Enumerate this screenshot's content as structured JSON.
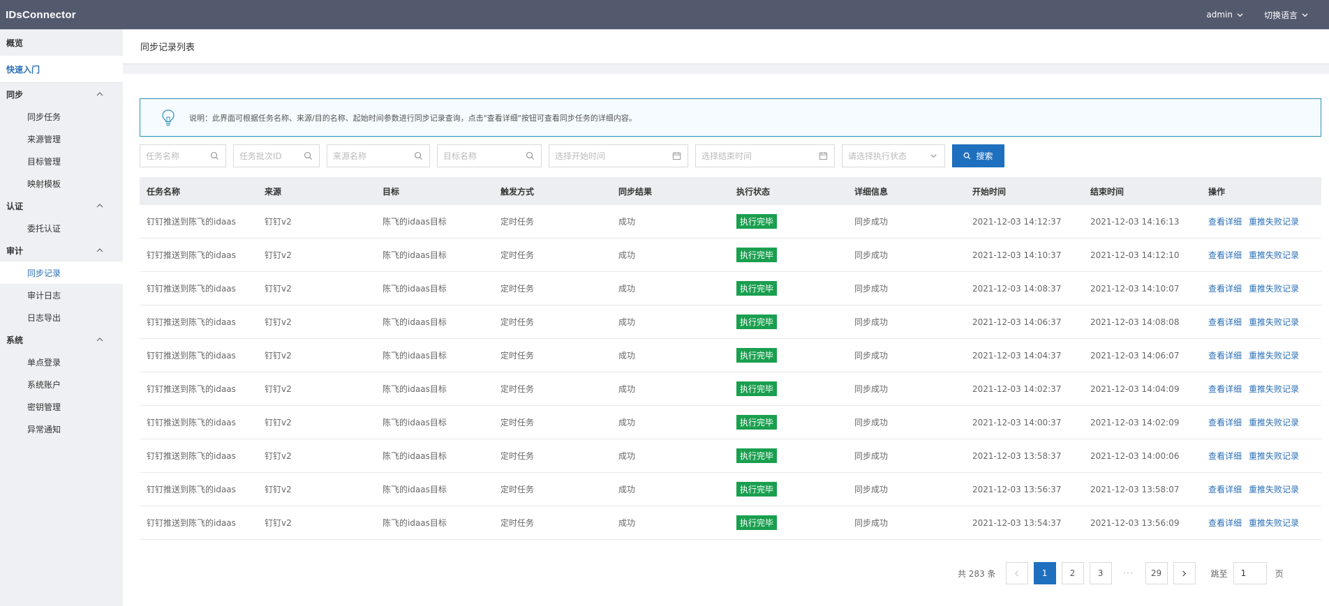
{
  "app": {
    "brand": "IDsConnector",
    "user": "admin",
    "language": "切换语言"
  },
  "sidebar": {
    "overview": "概览",
    "quickstart": "快速入门",
    "groups": [
      {
        "label": "同步",
        "items": [
          "同步任务",
          "来源管理",
          "目标管理",
          "映射模板"
        ]
      },
      {
        "label": "认证",
        "items": [
          "委托认证"
        ]
      },
      {
        "label": "审计",
        "items": [
          "同步记录",
          "审计日志",
          "日志导出"
        ]
      },
      {
        "label": "系统",
        "items": [
          "单点登录",
          "系统账户",
          "密钥管理",
          "异常通知"
        ]
      }
    ]
  },
  "page": {
    "title": "同步记录列表",
    "notice": "说明：此界面可根据任务名称、来源/目的名称、起始时间参数进行同步记录查询，点击\"查看详细\"按钮可查看同步任务的详细内容。"
  },
  "filters": {
    "task_name_placeholder": "任务名称",
    "batch_id_placeholder": "任务批次ID",
    "source_placeholder": "来源名称",
    "target_placeholder": "目标名称",
    "start_time_placeholder": "选择开始时间",
    "end_time_placeholder": "选择结束时间",
    "status_placeholder": "请选择执行状态",
    "search_label": "搜索"
  },
  "table": {
    "headers": [
      "任务名称",
      "来源",
      "目标",
      "触发方式",
      "同步结果",
      "执行状态",
      "详细信息",
      "开始时间",
      "结束时间",
      "操作"
    ],
    "action_view": "查看详细",
    "action_retry": "重推失败记录",
    "rows": [
      {
        "name": "钉钉推送到陈飞的idaas",
        "source": "钉钉v2",
        "target": "陈飞的idaas目标",
        "trigger": "定时任务",
        "result": "成功",
        "status": "执行完毕",
        "detail": "同步成功",
        "start": "2021-12-03 14:12:37",
        "end": "2021-12-03 14:16:13"
      },
      {
        "name": "钉钉推送到陈飞的idaas",
        "source": "钉钉v2",
        "target": "陈飞的idaas目标",
        "trigger": "定时任务",
        "result": "成功",
        "status": "执行完毕",
        "detail": "同步成功",
        "start": "2021-12-03 14:10:37",
        "end": "2021-12-03 14:12:10"
      },
      {
        "name": "钉钉推送到陈飞的idaas",
        "source": "钉钉v2",
        "target": "陈飞的idaas目标",
        "trigger": "定时任务",
        "result": "成功",
        "status": "执行完毕",
        "detail": "同步成功",
        "start": "2021-12-03 14:08:37",
        "end": "2021-12-03 14:10:07"
      },
      {
        "name": "钉钉推送到陈飞的idaas",
        "source": "钉钉v2",
        "target": "陈飞的idaas目标",
        "trigger": "定时任务",
        "result": "成功",
        "status": "执行完毕",
        "detail": "同步成功",
        "start": "2021-12-03 14:06:37",
        "end": "2021-12-03 14:08:08"
      },
      {
        "name": "钉钉推送到陈飞的idaas",
        "source": "钉钉v2",
        "target": "陈飞的idaas目标",
        "trigger": "定时任务",
        "result": "成功",
        "status": "执行完毕",
        "detail": "同步成功",
        "start": "2021-12-03 14:04:37",
        "end": "2021-12-03 14:06:07"
      },
      {
        "name": "钉钉推送到陈飞的idaas",
        "source": "钉钉v2",
        "target": "陈飞的idaas目标",
        "trigger": "定时任务",
        "result": "成功",
        "status": "执行完毕",
        "detail": "同步成功",
        "start": "2021-12-03 14:02:37",
        "end": "2021-12-03 14:04:09"
      },
      {
        "name": "钉钉推送到陈飞的idaas",
        "source": "钉钉v2",
        "target": "陈飞的idaas目标",
        "trigger": "定时任务",
        "result": "成功",
        "status": "执行完毕",
        "detail": "同步成功",
        "start": "2021-12-03 14:00:37",
        "end": "2021-12-03 14:02:09"
      },
      {
        "name": "钉钉推送到陈飞的idaas",
        "source": "钉钉v2",
        "target": "陈飞的idaas目标",
        "trigger": "定时任务",
        "result": "成功",
        "status": "执行完毕",
        "detail": "同步成功",
        "start": "2021-12-03 13:58:37",
        "end": "2021-12-03 14:00:06"
      },
      {
        "name": "钉钉推送到陈飞的idaas",
        "source": "钉钉v2",
        "target": "陈飞的idaas目标",
        "trigger": "定时任务",
        "result": "成功",
        "status": "执行完毕",
        "detail": "同步成功",
        "start": "2021-12-03 13:56:37",
        "end": "2021-12-03 13:58:07"
      },
      {
        "name": "钉钉推送到陈飞的idaas",
        "source": "钉钉v2",
        "target": "陈飞的idaas目标",
        "trigger": "定时任务",
        "result": "成功",
        "status": "执行完毕",
        "detail": "同步成功",
        "start": "2021-12-03 13:54:37",
        "end": "2021-12-03 13:56:09"
      }
    ]
  },
  "pagination": {
    "total_text": "共 283 条",
    "pages": [
      "1",
      "2",
      "3"
    ],
    "ellipsis": "···",
    "last_page": "29",
    "current": "1",
    "jump_label": "跳至",
    "jump_value": "1",
    "jump_unit": "页"
  },
  "colors": {
    "topbar": "#545a6e",
    "accent": "#1f6fbf",
    "link": "#2b6fb6",
    "success": "#1a9f4f"
  }
}
